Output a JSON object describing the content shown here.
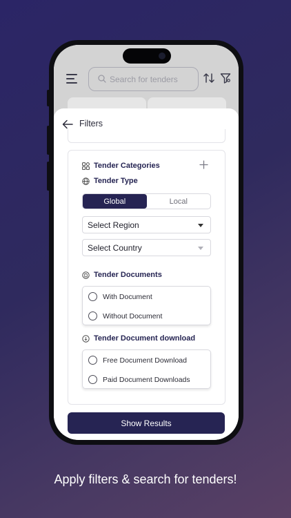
{
  "header": {
    "search_placeholder": "Search for tenders"
  },
  "filters": {
    "title": "Filters",
    "tender_categories_label": "Tender Categories",
    "tender_type_label": "Tender Type",
    "tender_type_options": [
      "Global",
      "Local"
    ],
    "tender_type_selected": "Global",
    "region_select": "Select Region",
    "country_select": "Select Country",
    "tender_documents_label": "Tender Documents",
    "tender_documents_options": [
      "With Document",
      "Without Document"
    ],
    "tender_download_label": "Tender Document download",
    "tender_download_options": [
      "Free Document Download",
      "Paid Document Downloads"
    ],
    "show_results_label": "Show Results"
  },
  "caption": "Apply filters & search for tenders!",
  "colors": {
    "primary": "#262453",
    "background_start": "#2b2566",
    "background_end": "#5a4064"
  }
}
